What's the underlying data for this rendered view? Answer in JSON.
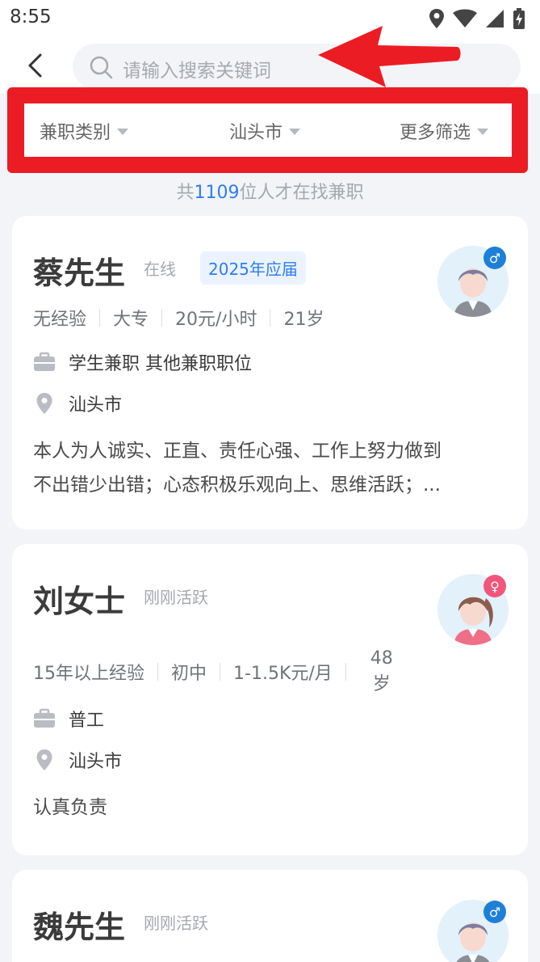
{
  "status_bar": {
    "time": "8:55"
  },
  "search": {
    "placeholder": "请输入搜索关键词"
  },
  "filters": {
    "category": "兼职类别",
    "city": "汕头市",
    "more": "更多筛选"
  },
  "summary": {
    "prefix": "共",
    "count": "1109",
    "suffix": "位人才在找兼职"
  },
  "candidates": [
    {
      "name": "蔡先生",
      "status": "在线",
      "tag": "2025年应届",
      "experience": "无经验",
      "education": "大专",
      "salary": "20元/小时",
      "age": "21岁",
      "position": "学生兼职 其他兼职职位",
      "location": "汕头市",
      "description_line1": "本人为人诚实、正直、责任心强、工作上努力做到",
      "description_line2": "不出错少出错；心态积极乐观向上、思维活跃；...",
      "gender_symbol": "♂"
    },
    {
      "name": "刘女士",
      "status": "刚刚活跃",
      "experience": "15年以上经验",
      "education": "初中",
      "salary": "1-1.5K元/月",
      "age_num": "48",
      "age_unit": "岁",
      "position": "普工",
      "location": "汕头市",
      "description_line1": "认真负责",
      "gender_symbol": "♀"
    },
    {
      "name": "魏先生",
      "status": "刚刚活跃",
      "gender_symbol": "♂"
    }
  ],
  "colors": {
    "accent": "#2f7cf6",
    "annotation_red": "#ec1c24",
    "male": "#1e7fd8",
    "female": "#f2557c"
  }
}
